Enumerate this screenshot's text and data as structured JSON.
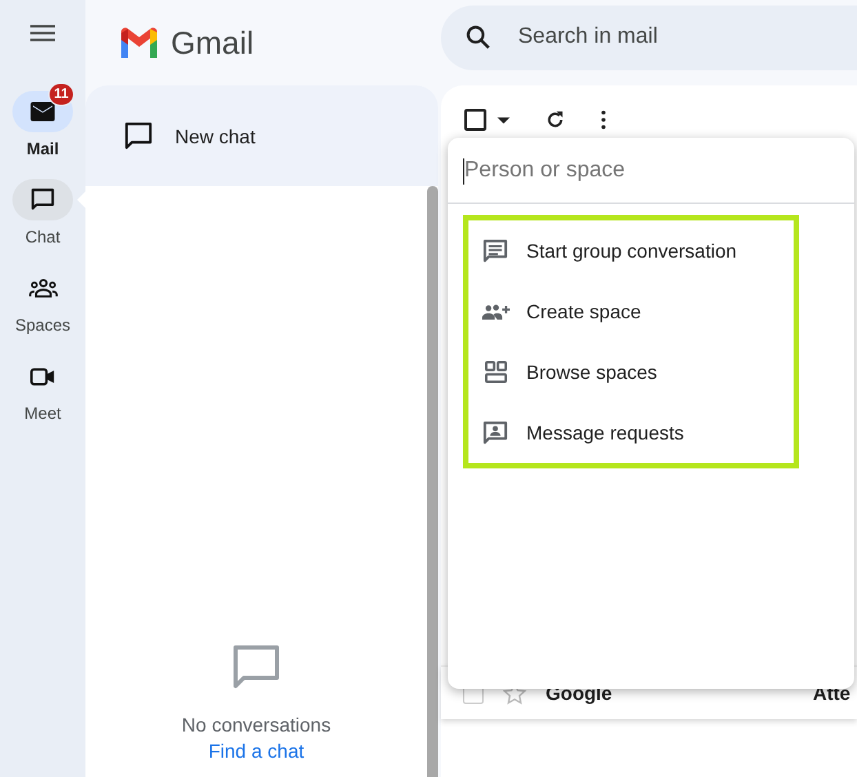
{
  "rail": {
    "items": [
      {
        "label": "Mail",
        "kind": "mail",
        "selected": true,
        "open": false,
        "badge": "11"
      },
      {
        "label": "Chat",
        "kind": "chat",
        "selected": false,
        "open": true
      },
      {
        "label": "Spaces",
        "kind": "spaces",
        "selected": false,
        "open": false
      },
      {
        "label": "Meet",
        "kind": "meet",
        "selected": false,
        "open": false
      }
    ]
  },
  "header": {
    "logo_text": "Gmail",
    "search": {
      "placeholder": "Search in mail"
    }
  },
  "chat_panel": {
    "new_chat": "New chat",
    "empty_text": "No conversations",
    "link": "Find a chat"
  },
  "mail_list": {
    "select_all_checked": false,
    "rows": [
      {
        "sender": "Google",
        "subject": "Atte",
        "checked": false
      }
    ]
  },
  "popup": {
    "search": {
      "placeholder": "Person or space"
    },
    "menu": {
      "highlighted": true,
      "items": [
        {
          "label": "Start group conversation",
          "kind": "group"
        },
        {
          "label": "Create space",
          "kind": "create"
        },
        {
          "label": "Browse spaces",
          "kind": "browse"
        },
        {
          "label": "Message requests",
          "kind": "requests"
        }
      ]
    }
  }
}
